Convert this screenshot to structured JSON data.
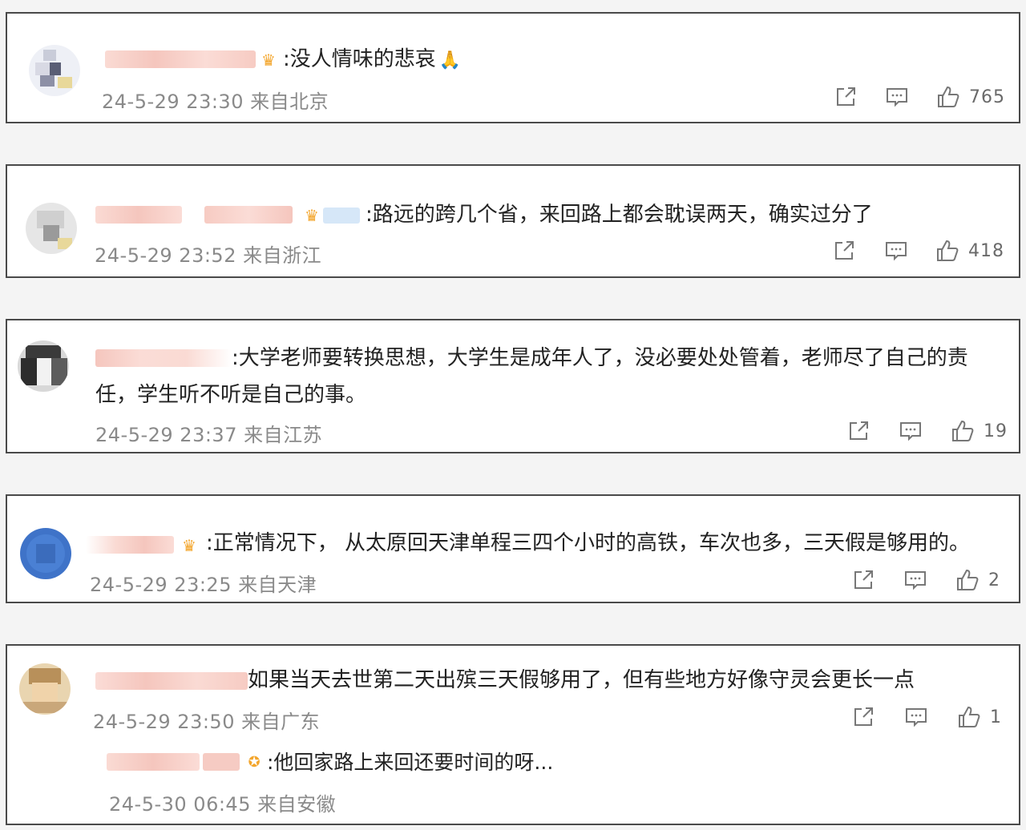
{
  "comments": [
    {
      "text": ":没人情味的悲哀",
      "emoji": "🙏",
      "time": "24-5-29 23:30",
      "location": "来自北京",
      "likes": "765"
    },
    {
      "text": ":路远的跨几个省，来回路上都会耽误两天，确实过分了",
      "time": "24-5-29 23:52",
      "location": "来自浙江",
      "likes": "418"
    },
    {
      "text_line1": ":大学老师要转换思想，大学生是成年人了，没必要处处管着，老师尽了自己的责",
      "text_line2": "任，学生听不听是自己的事。",
      "time": "24-5-29 23:37",
      "location": "来自江苏",
      "likes": "19"
    },
    {
      "text": ":正常情况下， 从太原回天津单程三四个小时的高铁，车次也多，三天假是够用的。",
      "time": "24-5-29 23:25",
      "location": "来自天津",
      "likes": "2"
    },
    {
      "text": "如果当天去世第二天出殡三天假够用了，但有些地方好像守灵会更长一点",
      "time": "24-5-29 23:50",
      "location": "来自广东",
      "likes": "1",
      "reply": {
        "text": ":他回家路上来回还要时间的呀...",
        "time": "24-5-30 06:45",
        "location": "来自安徽"
      }
    }
  ],
  "icons": {
    "share": "share-icon",
    "comment": "comment-icon",
    "like": "thumbs-up-icon",
    "badge": "crown-badge-icon"
  },
  "colors": {
    "border": "#4a4a4a",
    "meta": "#8a8a8a",
    "badge": "#f3a52b",
    "blurred_name": "#f6c9c0"
  }
}
